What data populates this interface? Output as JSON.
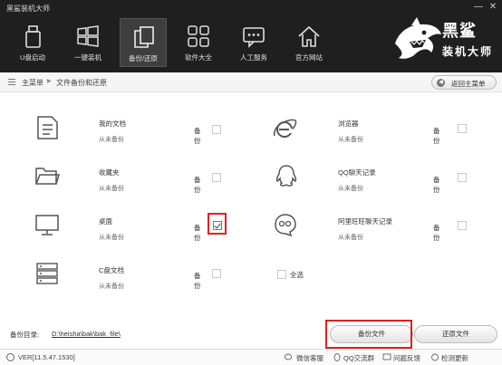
{
  "window": {
    "title": "黑鲨装机大师",
    "minimize_icon": "minimize-icon",
    "close_icon": "close-icon"
  },
  "nav": [
    {
      "label": "U盘启动",
      "icon": "usb-drive-icon",
      "active": false
    },
    {
      "label": "一键装机",
      "icon": "windows-icon",
      "active": false
    },
    {
      "label": "备份/还原",
      "icon": "copy-icon",
      "active": true
    },
    {
      "label": "软件大全",
      "icon": "apps-grid-icon",
      "active": false
    },
    {
      "label": "人工服务",
      "icon": "chat-icon",
      "active": false
    },
    {
      "label": "官方网站",
      "icon": "home-icon",
      "active": false
    }
  ],
  "logo": {
    "line1": "黑鲨",
    "line2": "装机大师"
  },
  "breadcrumb": {
    "home": "主菜单",
    "current": "文件备份和还原",
    "back_button": "返回主菜单"
  },
  "items": [
    {
      "name": "我的文档",
      "status": "从未备份",
      "backup_label": "备份",
      "checked": false,
      "icon": "document-icon"
    },
    {
      "name": "浏览器",
      "status": "从未备份",
      "backup_label": "备份",
      "checked": false,
      "icon": "ie-browser-icon"
    },
    {
      "name": "收藏夹",
      "status": "从未备份",
      "backup_label": "备份",
      "checked": false,
      "icon": "folder-icon"
    },
    {
      "name": "QQ聊天记录",
      "status": "从未备份",
      "backup_label": "备份",
      "checked": false,
      "icon": "qq-icon"
    },
    {
      "name": "桌面",
      "status": "从未备份",
      "backup_label": "备份",
      "checked": true,
      "icon": "monitor-icon"
    },
    {
      "name": "阿里旺旺聊天记录",
      "status": "从未备份",
      "backup_label": "备份",
      "checked": false,
      "icon": "aliwangwang-icon"
    },
    {
      "name": "C盘文档",
      "status": "从未备份",
      "backup_label": "备份",
      "checked": false,
      "icon": "server-drive-icon"
    }
  ],
  "select_all": {
    "label": "全选",
    "checked": false
  },
  "backup_dir": {
    "label": "备份目录:",
    "path": "D:\\heisha\\bak\\bak_file\\"
  },
  "buttons": {
    "backup": "备份文件",
    "restore": "还原文件"
  },
  "footer": {
    "version": "VER[11.5.47.1530]",
    "links": [
      "微信客服",
      "QQ交流群",
      "问题反馈",
      "检测更新"
    ]
  }
}
